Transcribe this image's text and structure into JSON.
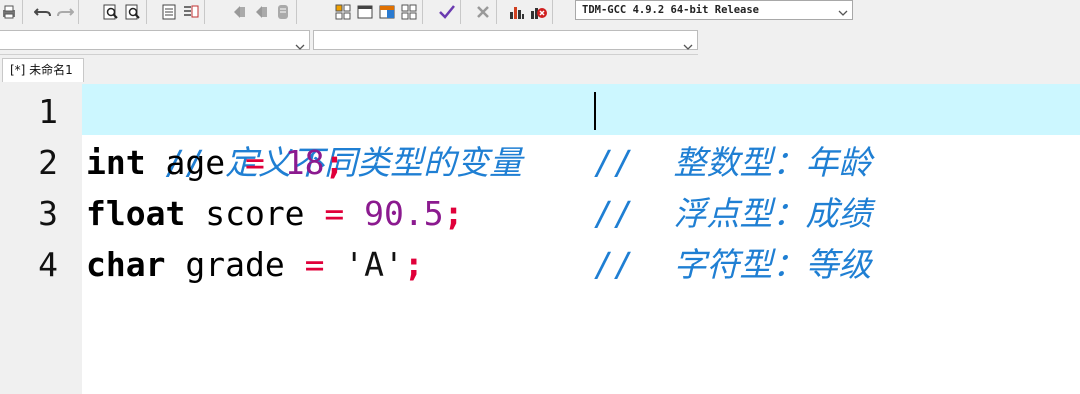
{
  "toolbar": {
    "compiler_value": "TDM-GCC 4.9.2 64-bit Release"
  },
  "tab": {
    "label": "[*] 未命名1"
  },
  "editor": {
    "line_numbers": [
      "1",
      "2",
      "3",
      "4"
    ],
    "line1": {
      "comment": "// 定义不同类型的变量"
    },
    "line2": {
      "type": "int",
      "name": " age ",
      "eq": "=",
      "value": " 18",
      "semi": ";",
      "comment": "//  整数型：年龄"
    },
    "line3": {
      "type": "float",
      "name": " score ",
      "eq": "=",
      "value": " 90.5",
      "semi": ";",
      "comment": "//  浮点型：成绩"
    },
    "line4": {
      "type": "char",
      "name": " grade ",
      "eq": "=",
      "value": " 'A'",
      "semi": ";",
      "comment": "//  字符型：等级"
    }
  },
  "colors": {
    "current_line": "#ccf7ff",
    "comment": "#1f7fd3",
    "operator": "#e0003a",
    "number": "#8b1a8f"
  }
}
